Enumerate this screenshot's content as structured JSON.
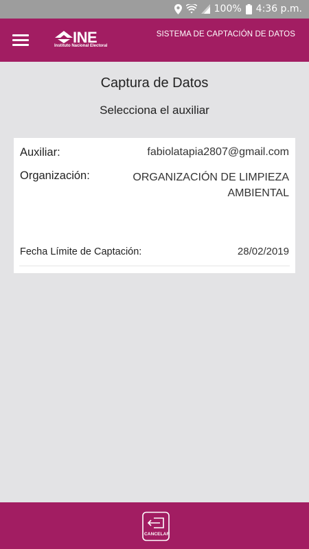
{
  "status_bar": {
    "battery": "100%",
    "time": "4:36 p.m."
  },
  "header": {
    "logo_text": "INE",
    "logo_subtext": "Instituto Nacional Electoral",
    "title": "SISTEMA DE CAPTACIÓN DE DATOS"
  },
  "main": {
    "title": "Captura de Datos",
    "subtitle": "Selecciona el auxiliar"
  },
  "card": {
    "auxiliar_label": "Auxiliar:",
    "auxiliar_value": "fabiolatapia2807@gmail.com",
    "organizacion_label": "Organización:",
    "organizacion_value": "ORGANIZACIÓN DE LIMPIEZA AMBIENTAL",
    "fecha_label": "Fecha Límite de Captación:",
    "fecha_value": "28/02/2019"
  },
  "footer": {
    "cancel_label": "CANCELAR"
  },
  "colors": {
    "brand": "#a21d62",
    "status_bar": "#9d9d9d",
    "background": "#e3e3e5"
  }
}
